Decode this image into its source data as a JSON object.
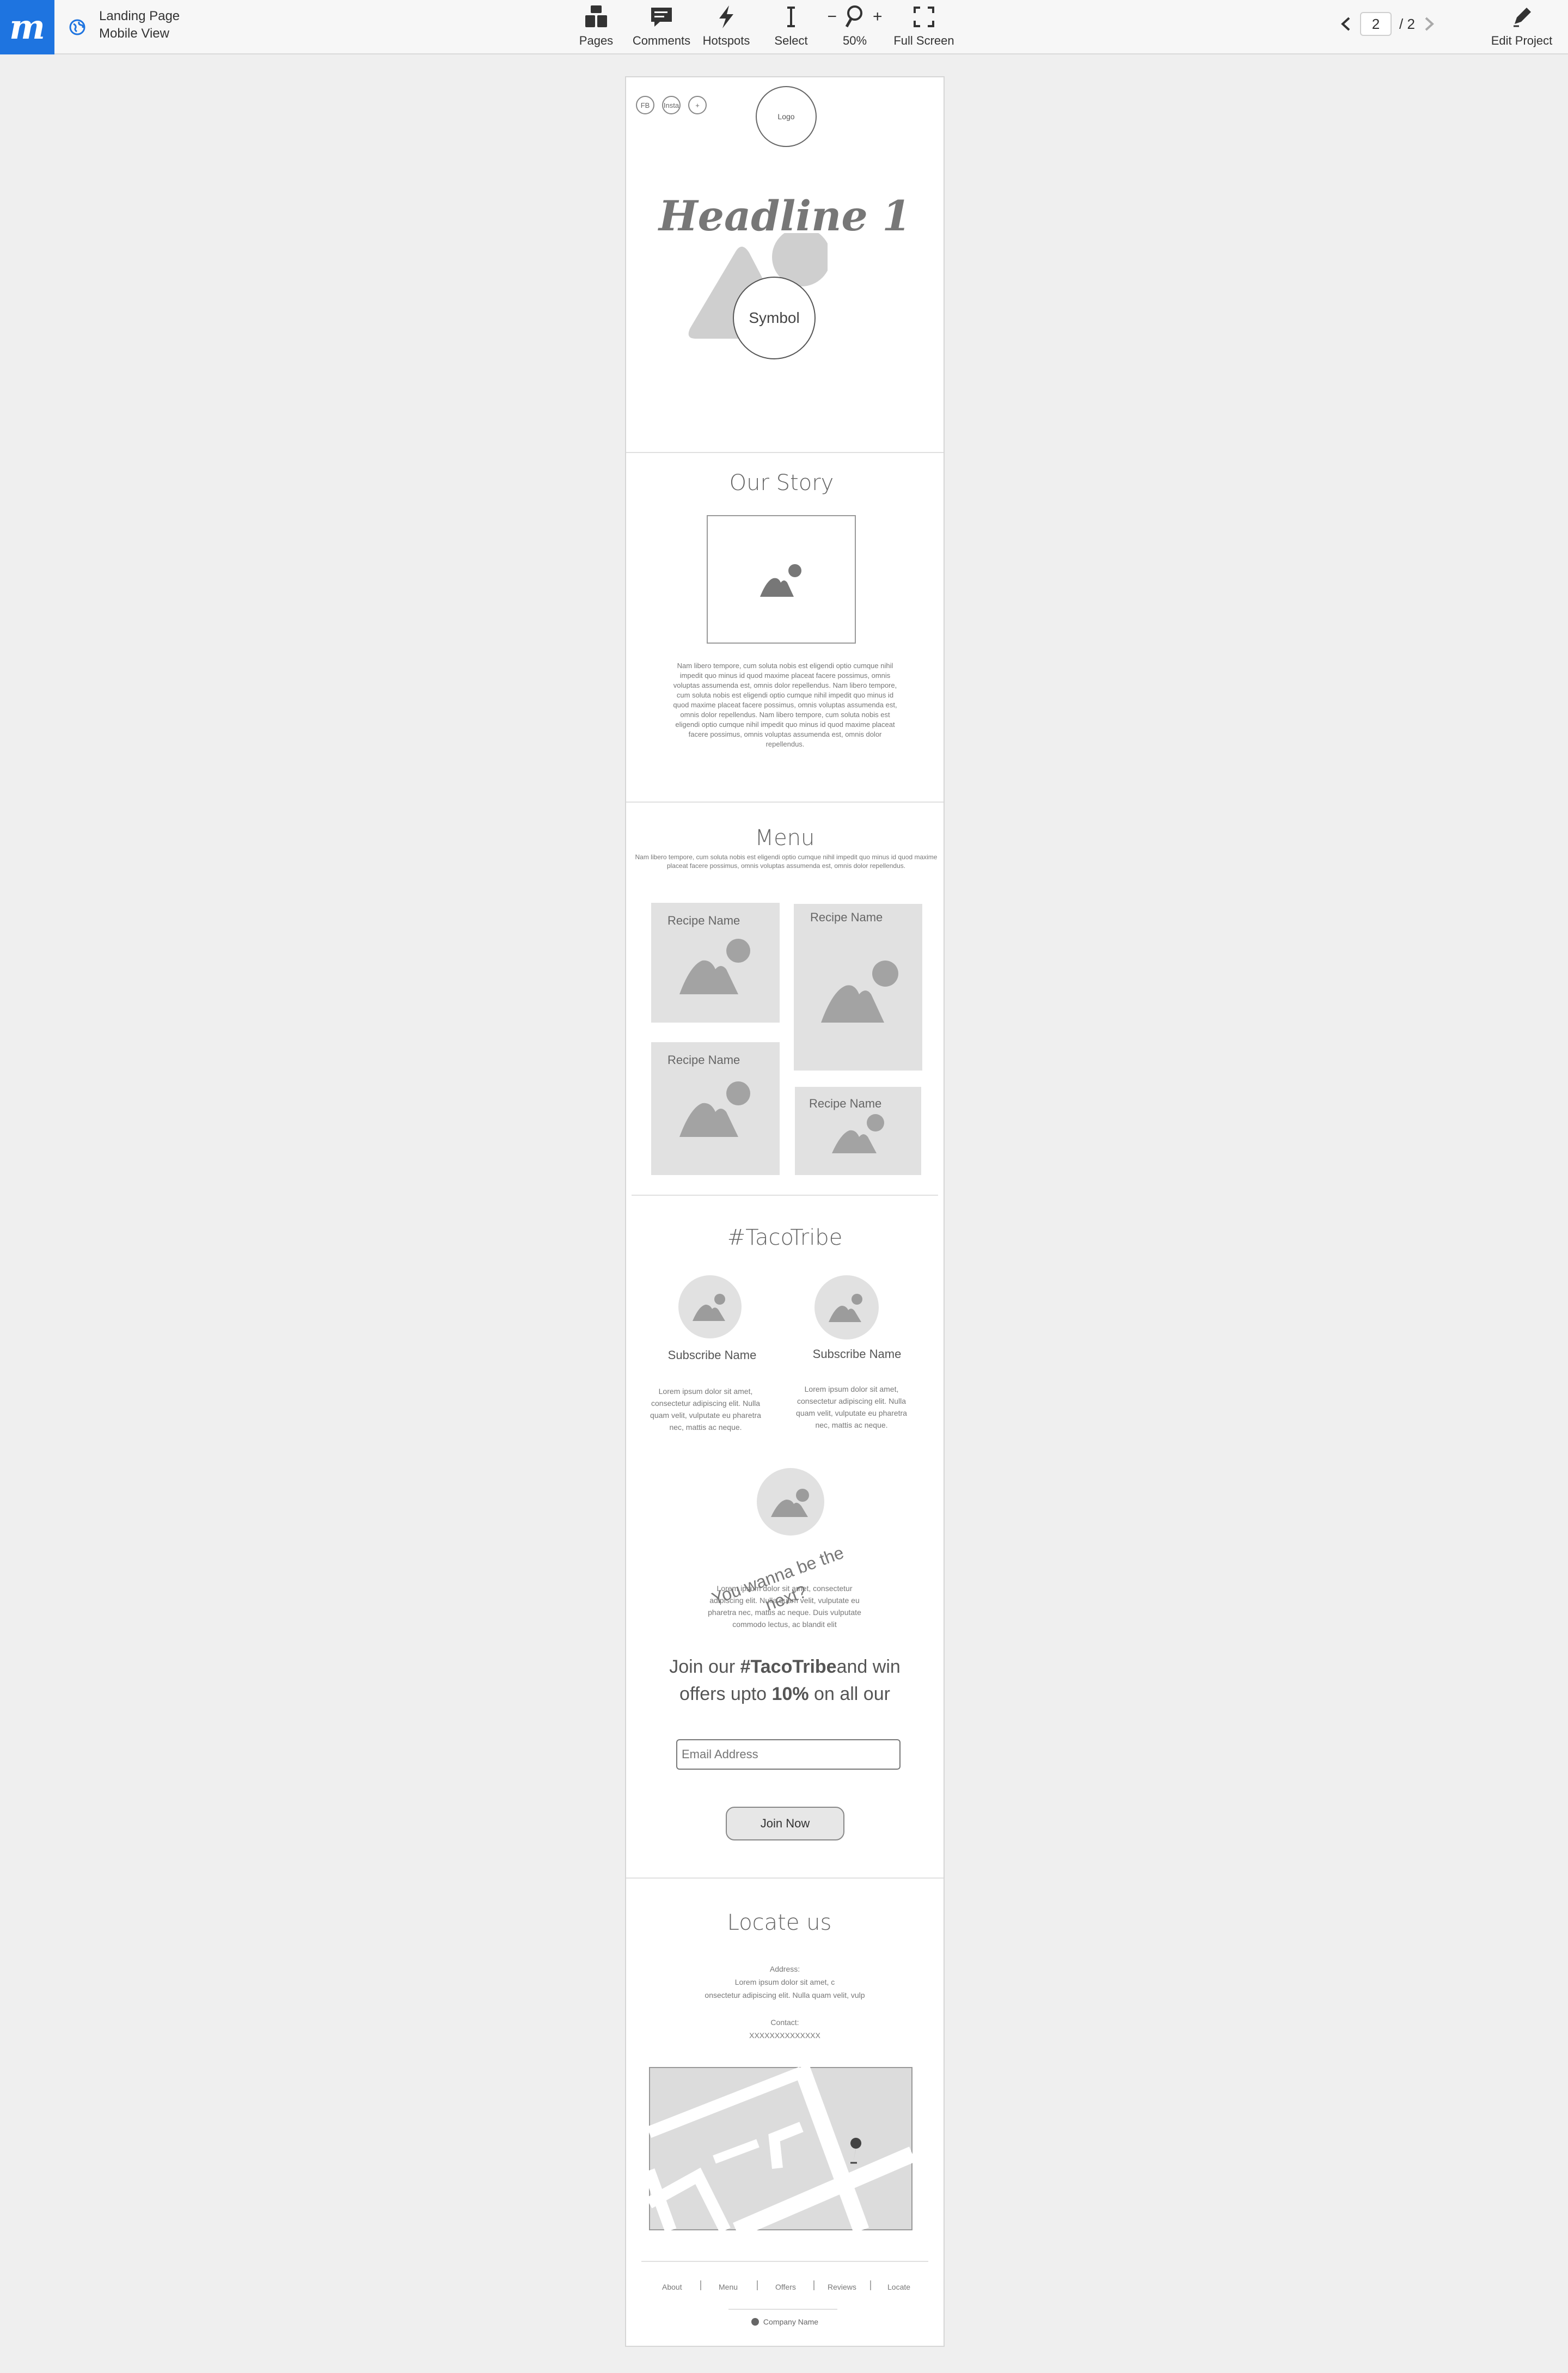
{
  "app": {
    "logo_letter": "m",
    "project_title": "Landing Page",
    "project_subtitle": "Mobile View",
    "accent_color": "#1e74e0"
  },
  "toolbar": {
    "pages": "Pages",
    "comments": "Comments",
    "hotspots": "Hotspots",
    "select": "Select",
    "zoom_minus": "−",
    "zoom_plus": "+",
    "zoom_level": "50%",
    "full_screen": "Full Screen",
    "edit_project": "Edit Project"
  },
  "pager": {
    "current": "2",
    "total": "/ 2"
  },
  "hero": {
    "social": [
      "FB",
      "Insta",
      "+"
    ],
    "logo": "Logo",
    "headline": "Headline 1",
    "symbol": "Symbol"
  },
  "story": {
    "title": "Our Story",
    "body": "Nam libero tempore, cum soluta nobis est eligendi optio cumque nihil impedit quo minus id quod maxime placeat facere possimus, omnis voluptas assumenda est, omnis dolor repellendus. Nam libero tempore, cum soluta nobis est eligendi optio cumque nihil impedit quo minus id quod maxime placeat facere possimus, omnis voluptas assumenda est, omnis dolor repellendus. Nam libero tempore, cum soluta nobis est eligendi optio cumque nihil impedit quo minus id quod maxime placeat facere possimus, omnis voluptas assumenda est, omnis dolor repellendus."
  },
  "menu": {
    "title": "Menu",
    "intro": "Nam libero tempore, cum soluta nobis est eligendi optio cumque nihil impedit quo minus id quod maxime placeat facere possimus, omnis voluptas assumenda est, omnis dolor repellendus.",
    "recipe_label": "Recipe Name"
  },
  "tribe": {
    "title": "#TacoTribe",
    "subscriber_name": "Subscribe Name",
    "subscriber_text": "Lorem ipsum dolor sit amet, consectetur adipiscing elit. Nulla quam velit, vulputate eu pharetra nec, mattis ac neque.",
    "next_title": "You wanna be the next?",
    "next_text": "Lorem ipsum dolor sit amet, consectetur adipiscing elit. Nulla quam velit, vulputate eu pharetra nec, mattis ac neque. Duis vulputate commodo lectus, ac blandit elit",
    "join_pre": "Join our ",
    "join_bold": "#TacoTribe",
    "join_mid": "and win",
    "join_line2_pre": "offers upto ",
    "join_line2_bold": "10%",
    "join_line2_post": " on all our",
    "email_placeholder": "Email Address",
    "join_button": "Join Now"
  },
  "locate": {
    "title": "Locate us",
    "address_label": "Address:",
    "address_line1": "Lorem ipsum dolor sit amet, c",
    "address_line2": "onsectetur adipiscing elit. Nulla quam velit, vulp",
    "contact_label": "Contact:",
    "contact_value": "XXXXXXXXXXXXXX"
  },
  "footer": {
    "links": [
      "About",
      "Menu",
      "Offers",
      "Reviews",
      "Locate"
    ],
    "company": "Company Name"
  }
}
